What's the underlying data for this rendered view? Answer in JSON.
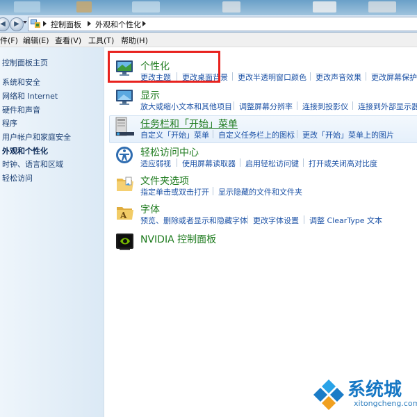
{
  "breadcrumb": [
    "控制面板",
    "外观和个性化"
  ],
  "menus": [
    "件(F)",
    "编辑(E)",
    "查看(V)",
    "工具(T)",
    "帮助(H)"
  ],
  "sidebar": {
    "items": [
      "控制面板主页",
      "系统和安全",
      "网络和 Internet",
      "硬件和声音",
      "程序",
      "用户帐户和家庭安全",
      "外观和个性化",
      "时钟、语言和区域",
      "轻松访问"
    ],
    "current": "外观和个性化"
  },
  "categories": [
    {
      "title": "个性化",
      "links": [
        "更改主题",
        "更改桌面背景",
        "更改半透明窗口颜色",
        "更改声音效果",
        "更改屏幕保护"
      ]
    },
    {
      "title": "显示",
      "links": [
        "放大或缩小文本和其他项目",
        "调整屏幕分辨率",
        "连接到投影仪",
        "连接到外部显示器"
      ]
    },
    {
      "title": "任务栏和「开始」菜单",
      "links": [
        "自定义「开始」菜单",
        "自定义任务栏上的图标",
        "更改「开始」菜单上的图片"
      ]
    },
    {
      "title": "轻松访问中心",
      "links": [
        "适应弱视",
        "使用屏幕读取器",
        "启用轻松访问键",
        "打开或关闭高对比度"
      ]
    },
    {
      "title": "文件夹选项",
      "links": [
        "指定单击或双击打开",
        "显示隐藏的文件和文件夹"
      ]
    },
    {
      "title": "字体",
      "links": [
        "预览、删除或者显示和隐藏字体",
        "更改字体设置",
        "调整 ClearType 文本"
      ]
    },
    {
      "title": "NVIDIA 控制面板",
      "links": []
    }
  ],
  "watermark": {
    "brand": "系统城",
    "url": "xitongcheng.com"
  },
  "colors": {
    "category_title": "#1c7a1c",
    "link": "#1c52a6",
    "highlight_box": "#e8221e",
    "watermark": "#1577c4"
  }
}
